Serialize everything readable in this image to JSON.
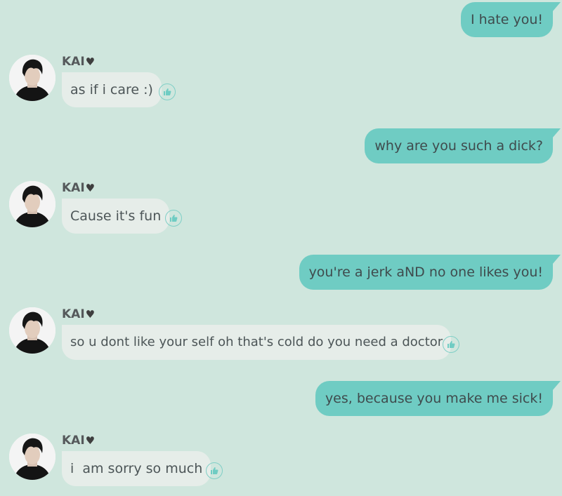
{
  "messages": [
    {
      "side": "out",
      "text": "I hate you!"
    },
    {
      "side": "in",
      "sender": "KAI",
      "heart": "♥",
      "text": "as if i care :)"
    },
    {
      "side": "out",
      "text": "why are you such a dick?"
    },
    {
      "side": "in",
      "sender": "KAI",
      "heart": "♥",
      "text": "Cause it's fun"
    },
    {
      "side": "out",
      "text": "you're a jerk aND no one likes you!"
    },
    {
      "side": "in",
      "sender": "KAI",
      "heart": "♥",
      "text": "so u dont like your self oh that's cold do you need a doctor"
    },
    {
      "side": "out",
      "text": "yes, because you make me sick!"
    },
    {
      "side": "in",
      "sender": "KAI",
      "heart": "♥",
      "text": "i  am sorry so much"
    }
  ],
  "colors": {
    "background": "#cfe6dd",
    "outgoing_bubble": "#6fccc3",
    "incoming_bubble": "#e6ede9",
    "like_icon": "#6fccc3"
  },
  "icons": {
    "like": "thumbs-up-icon",
    "avatar": "user-avatar"
  }
}
